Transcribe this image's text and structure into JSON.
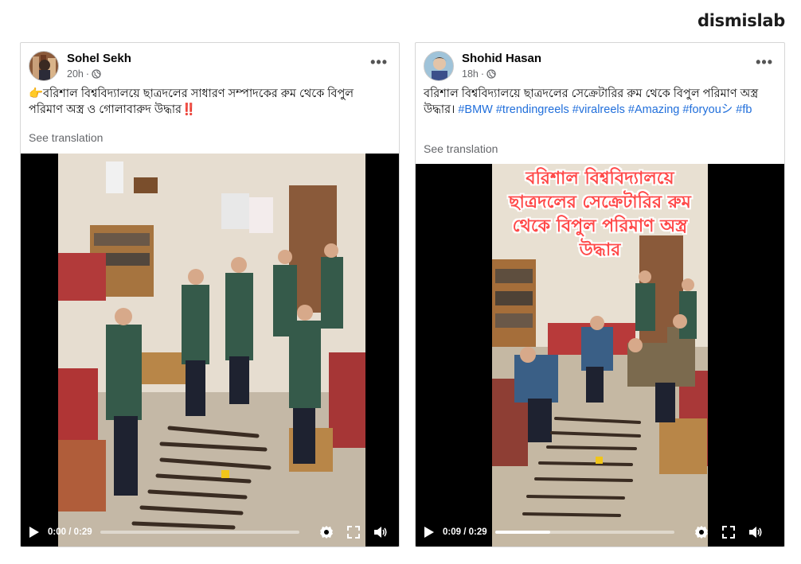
{
  "brand": "dismislab",
  "posts": [
    {
      "author": "Sohel Sekh",
      "time": "20h",
      "caption": "👉বরিশাল বিশ্ববিদ্যালয়ে ছাত্রদলের সাধারণ সম্পাদকের রুম থেকে বিপুল পরিমাণ অস্ত্র ও গোলাবারুদ উদ্ধার‼️",
      "see_translation": "See translation",
      "video": {
        "time_display": "0:00 / 0:29",
        "progress": 0.0
      }
    },
    {
      "author": "Shohid Hasan",
      "time": "18h",
      "caption": "বরিশাল বিশ্ববিদ্যালয়ে ছাত্রদলের সেক্রেটারির রুম থেকে বিপুল পরিমাণ অস্ত্র উদ্ধার।",
      "hashtags": "#BMW #trendingreels #viralreels #Amazing #foryouシ #fb",
      "see_translation": "See translation",
      "video": {
        "time_display": "0:09 / 0:29",
        "progress": 0.31,
        "overlay_text": "বরিশাল বিশ্ববিদ্যালয়ে ছাত্রদলের সেক্রেটারির রুম থেকে বিপুল পরিমাণ অস্ত্র উদ্ধার"
      }
    }
  ],
  "icons": {
    "play": "play-icon",
    "settings": "gear-icon",
    "fullscreen": "expand-icon",
    "volume": "volume-icon",
    "audience": "globe-icon",
    "more": "more-options-icon"
  }
}
